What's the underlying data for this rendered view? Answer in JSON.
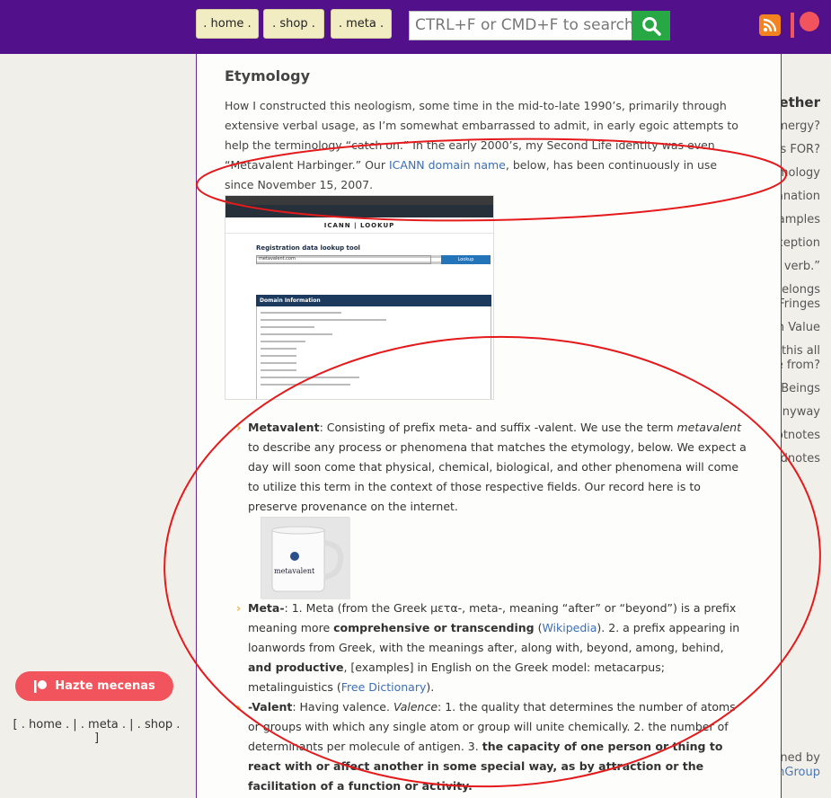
{
  "nav": {
    "home": ". home .",
    "shop": ". shop .",
    "meta": ". meta ."
  },
  "search": {
    "placeholder": "CTRL+F or CMD+F to search"
  },
  "icons": {
    "search": "magnifier-icon",
    "rss": "rss-icon",
    "patreon": "patreon-icon"
  },
  "colors": {
    "topbar": "#52118a",
    "link": "#3d6fb4",
    "accent": "#f1545c",
    "annotation": "#e41a1c"
  },
  "sidebar": {
    "title": "We’re Inquiring Together",
    "items": [
      "What is Metavalent Stigmergy?",
      "What is this FOR?",
      "Etymology",
      "The Fifth Grade Explanation",
      "Examples",
      "Process and Perception",
      "“I seem to be a verb.”",
      "Scientific Exploration Belongs",
      "at the Fringes",
      "Curation Value",
      "Right, but where did this all",
      "come from?",
      "For All Sentient Beings",
      "Do it, anyway",
      "Footnotes",
      "Endnotes"
    ],
    "patreon_button": "Hazte mecenas",
    "footer_nav": "[ . home . | . meta . | . shop . ]",
    "maintained_by": "Project maintained by",
    "maintainer": "GlobalCognitionGroup"
  },
  "article": {
    "heading": "Etymology",
    "intro_before_link": "How I constructed this neologism, some time in the mid-to-late 1990’s, primarily through extensive verbal usage, as I’m somewhat embarrassed to admit, in early egoic attempts to help the terminology “catch on.” In the early 2000’s, my Second Life identity was even “Metavalent Harbinger.” Our ",
    "intro_link": "ICANN domain name",
    "intro_after_link": ", below, has been continuously in use since November 15, 2007.",
    "screenshot": {
      "brand": "ICANN | LOOKUP",
      "title": "Registration data lookup tool",
      "input_value": "metavalent.com",
      "button": "Lookup",
      "section": "Domain Information"
    },
    "items": [
      {
        "term": "Metavalent",
        "text_a": ": Consisting of prefix meta- and suffix -valent. We use the term ",
        "italic": "metavalent",
        "text_b": " to describe any process or phenomena that matches the etymology, below. We expect a day will soon come that physical, chemical, biological, and other phenomena will come to utilize this term in the context of those respective fields. Our record here is to preserve provenance on the internet.",
        "image_label": "metavalent"
      },
      {
        "term": "Meta-",
        "text_a": ": 1. Meta (from the Greek μετα-, meta-, meaning “after” or “beyond”) is a prefix meaning more ",
        "bold_a": "comprehensive or transcending",
        "text_b": " (",
        "link_a": "Wikipedia",
        "text_c": "). 2. a prefix appearing in loanwords from Greek, with the meanings after, along with, beyond, among, behind, ",
        "bold_b": "and productive",
        "text_d": ", [examples] in English on the Greek model: metacarpus; metalinguistics (",
        "link_b": "Free Dictionary",
        "text_e": ")."
      },
      {
        "term": "-Valent",
        "text_a": ": Having valence. ",
        "italic": "Valence",
        "text_b": ": 1. the quality that determines the number of atoms or groups with which any single atom or group will unite chemically. 2. the number of determinants per molecule of antigen. 3. ",
        "bold_a": "the capacity of one person or thing to react with or affect another in some special way, as by attraction or the facilitation of a function or activity."
      }
    ]
  }
}
